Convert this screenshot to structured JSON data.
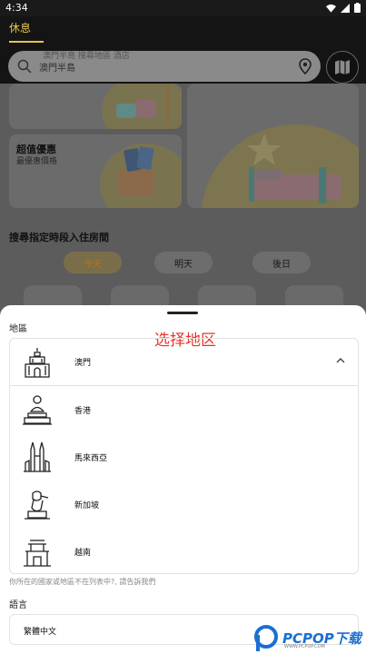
{
  "status_bar": {
    "time": "4:34"
  },
  "header": {
    "active_tab": "休息",
    "search": {
      "ghost_text": "澳門半島 搜尋地區 酒店",
      "value": "澳門半島"
    }
  },
  "content": {
    "card_deal": {
      "title": "超值優惠",
      "subtitle": "最優惠價格"
    },
    "section_title": "搜尋指定時段入住房間",
    "days": [
      "今天",
      "明天",
      "後日"
    ]
  },
  "sheet": {
    "annotation": "选择地区",
    "region_label": "地區",
    "regions": [
      {
        "name": "澳門",
        "icon": "macau-ruins-icon"
      },
      {
        "name": "香港",
        "icon": "buddha-statue-icon"
      },
      {
        "name": "馬來西亞",
        "icon": "petronas-towers-icon"
      },
      {
        "name": "新加坡",
        "icon": "merlion-icon"
      },
      {
        "name": "越南",
        "icon": "pagoda-gate-icon"
      }
    ],
    "hint": "你所在的國家或地區不在列表中?, 請告訴我們",
    "language_label": "語言",
    "language_value": "繁體中文"
  },
  "watermark": {
    "brand": "PCPOP下载",
    "sub": "WWW.PCPOP.COM"
  },
  "colors": {
    "accent": "#e6c34f",
    "annotation": "#e8332a",
    "watermark": "#1a6fd1"
  }
}
